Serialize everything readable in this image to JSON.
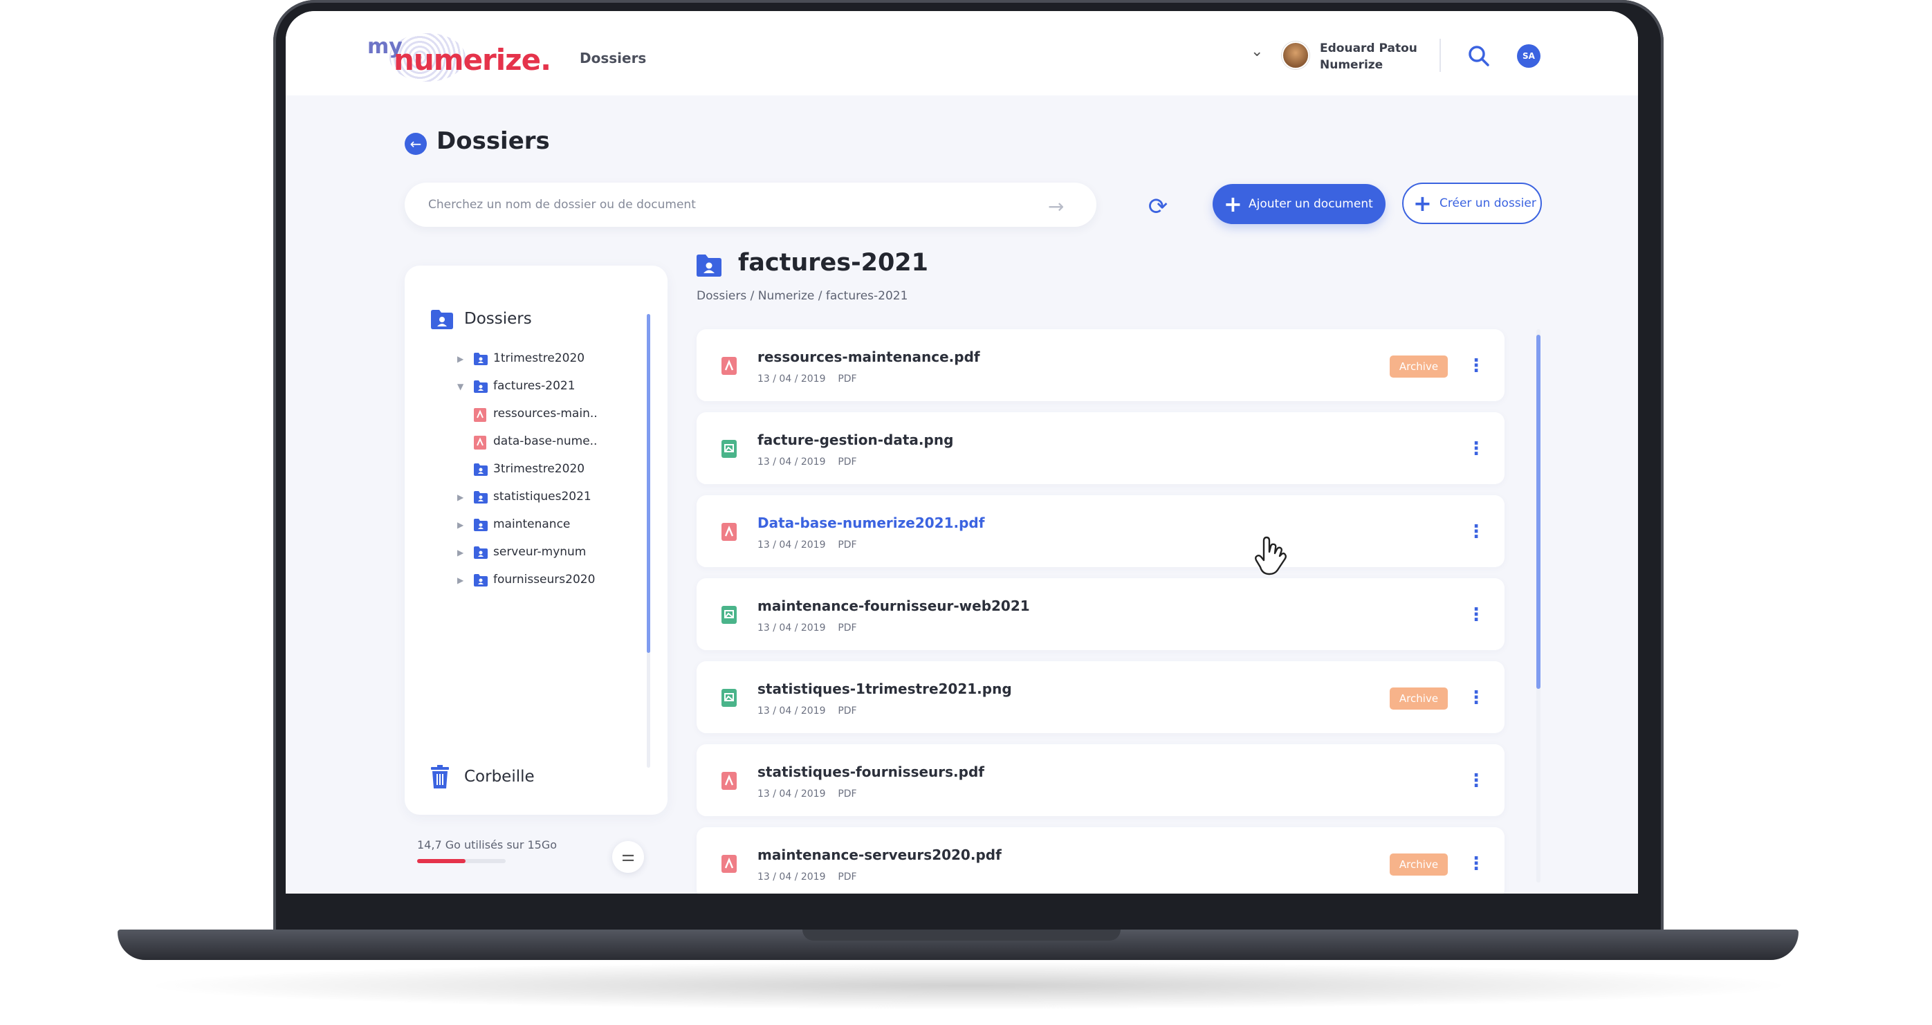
{
  "header": {
    "logo_prefix": "my",
    "logo_main": "numerize.",
    "nav_link": "Dossiers",
    "user_name": "Edouard Patou",
    "user_org": "Numerize",
    "user_initials": "SA"
  },
  "page": {
    "title": "Dossiers",
    "search_placeholder": "Cherchez un nom de dossier ou de document",
    "add_document_label": "Ajouter un document",
    "create_folder_label": "Créer un dossier"
  },
  "sidebar": {
    "title": "Dossiers",
    "tree": [
      {
        "label": "1trimestre2020",
        "type": "folder",
        "expanded": false
      },
      {
        "label": "factures-2021",
        "type": "folder",
        "expanded": true
      },
      {
        "label": "ressources-main..",
        "type": "pdf"
      },
      {
        "label": "data-base-nume..",
        "type": "pdf"
      },
      {
        "label": "3trimestre2020",
        "type": "folder"
      },
      {
        "label": "statistiques2021",
        "type": "folder",
        "expanded": false
      },
      {
        "label": "maintenance",
        "type": "folder",
        "expanded": false
      },
      {
        "label": "serveur-mynum",
        "type": "folder",
        "expanded": false
      },
      {
        "label": "fournisseurs2020",
        "type": "folder",
        "expanded": false
      }
    ],
    "trash_label": "Corbeille",
    "storage_text": "14,7 Go utilisés sur 15Go",
    "storage_fraction": 0.55
  },
  "folder": {
    "title": "factures-2021",
    "breadcrumb": "Dossiers / Numerize / factures-2021"
  },
  "files": [
    {
      "name": "ressources-maintenance.pdf",
      "date": "13 / 04 / 2019",
      "type": "PDF",
      "icon": "pdf-icon",
      "archive": "Archive",
      "highlight": false
    },
    {
      "name": "facture-gestion-data.png",
      "date": "13 / 04 / 2019",
      "type": "PDF",
      "icon": "image-icon",
      "archive": "",
      "highlight": false
    },
    {
      "name": "Data-base-numerize2021.pdf",
      "date": "13 / 04 / 2019",
      "type": "PDF",
      "icon": "pdf-icon",
      "archive": "",
      "highlight": true
    },
    {
      "name": "maintenance-fournisseur-web2021",
      "date": "13 / 04 / 2019",
      "type": "PDF",
      "icon": "image-icon",
      "archive": "",
      "highlight": false
    },
    {
      "name": "statistiques-1trimestre2021.png",
      "date": "13 / 04 / 2019",
      "type": "PDF",
      "icon": "image-icon",
      "archive": "Archive",
      "highlight": false
    },
    {
      "name": "statistiques-fournisseurs.pdf",
      "date": "13 / 04 / 2019",
      "type": "PDF",
      "icon": "pdf-icon",
      "archive": "",
      "highlight": false
    },
    {
      "name": "maintenance-serveurs2020.pdf",
      "date": "13 / 04 / 2019",
      "type": "PDF",
      "icon": "pdf-icon",
      "archive": "Archive",
      "highlight": false
    }
  ],
  "colors": {
    "accent": "#3b63e0",
    "brand_red": "#e5334b",
    "archive_badge": "#f7b38a",
    "pdf_icon": "#ef7d86",
    "image_icon": "#4ab48a"
  }
}
